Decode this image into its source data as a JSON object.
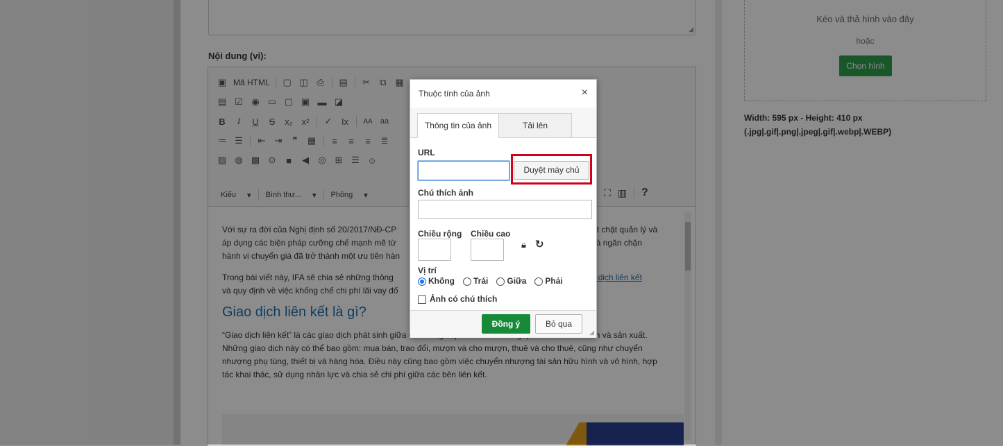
{
  "page": {
    "content_label": "Nội dung (vi):",
    "toolbar": {
      "source_label": "Mã HTML",
      "style_combo": "Kiểu",
      "format_combo": "Bình thư...",
      "font_combo": "Phông",
      "font_case": "AA",
      "font_lower": "aa"
    },
    "content": {
      "p1": "Với sự ra đời của Nghị định số 20/2017/NĐ-CP … nhất chặt quản lý và áp dụng các biện pháp cưỡng chế mạnh mẽ từ … n kết và ngăn chặn hành vi chuyển giá đã trở thành một ưu tiên hàn…",
      "p1_a": "Với sự ra đời của Nghị định số 20/2017/NĐ-CP",
      "p1_b": "nhất chặt quản lý và",
      "p1_c": "áp dụng các biện pháp cưỡng chế mạnh mẽ từ",
      "p1_d": "n kết và ngăn chặn",
      "p1_e": "hành vi chuyển giá đã trở thành một ưu tiên hàn",
      "p2_a": "Trong bài viết này, IFA sẽ chia sẻ những thông",
      "p2_link": "giao dịch liên kết",
      "p2_b": "và quy định về việc khống chế chi phí lãi vay đố",
      "heading": "Giao dịch liên kết là gì?",
      "p3": "“Giao dịch liên kết” là các giao dịch phát sinh giữa doanh nghiệp và tổ chức trong quá trình kinh doanh và sản xuất. Những giao dịch này có thể bao gồm: mua bán, trao đổi, mượn và cho mượn, thuê và cho thuê, cũng như chuyển nhượng phụ tùng, thiết bị và hàng hóa. Điều này cũng bao gồm việc chuyển nhượng tài sản hữu hình và vô hình, hợp tác khai thác, sử dụng nhân lực và chia sẻ chi phí giữa các bên liên kết."
    }
  },
  "image_panel": {
    "drop_text": "Kéo và thả hình vào đây",
    "or_text": "hoặc",
    "choose_button": "Chọn hình",
    "size_line": "Width: 595 px - Height: 410 px",
    "formats_line": "(.jpg|.gif|.png|.jpeg|.gif|.webp|.WEBP)"
  },
  "dialog": {
    "title": "Thuộc tính của ảnh",
    "close": "×",
    "tabs": [
      "Thông tin của ảnh",
      "Tải lên"
    ],
    "url_label": "URL",
    "url_value": "",
    "browse_button": "Duyệt máy chủ",
    "caption_label": "Chú thích ảnh",
    "width_label": "Chiều rộng",
    "height_label": "Chiều cao",
    "align_label": "Vị trí",
    "align_options": [
      "Không",
      "Trái",
      "Giữa",
      "Phải"
    ],
    "align_selected": "Không",
    "captioned_label": "Ảnh có chú thích",
    "ok_button": "Đồng ý",
    "cancel_button": "Bỏ qua"
  },
  "colors": {
    "highlight_box": "#d0021b",
    "ok_green": "#178a3a",
    "link_blue": "#1f6fb0"
  }
}
